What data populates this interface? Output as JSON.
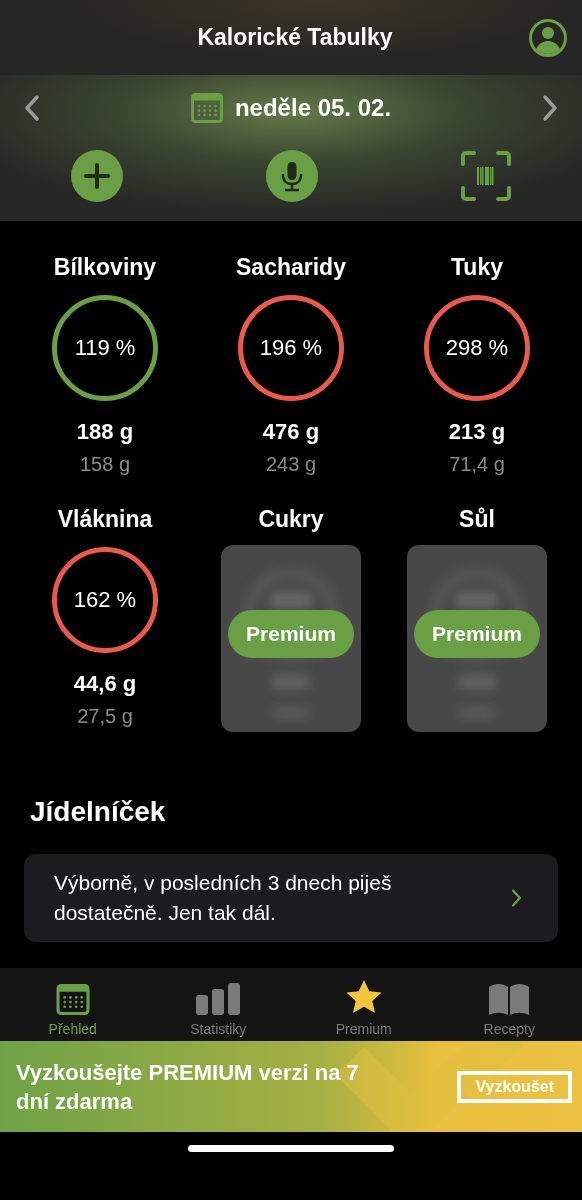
{
  "header": {
    "title": "Kalorické Tabulky"
  },
  "date_bar": {
    "date": "neděle 05. 02."
  },
  "actions": [
    {
      "kind": "add"
    },
    {
      "kind": "voice"
    },
    {
      "kind": "scan"
    }
  ],
  "nutrients": [
    {
      "kind": "ring",
      "name": "Bílkoviny",
      "percent": "119 %",
      "color": "#6a9f45",
      "amount": "188 g",
      "target": "158 g"
    },
    {
      "kind": "ring",
      "name": "Sacharidy",
      "percent": "196 %",
      "color": "#e85a4a",
      "amount": "476 g",
      "target": "243 g"
    },
    {
      "kind": "ring",
      "name": "Tuky",
      "percent": "298 %",
      "color": "#e85a4a",
      "amount": "213 g",
      "target": "71,4 g"
    },
    {
      "kind": "ring",
      "name": "Vláknina",
      "percent": "162 %",
      "color": "#e85a4a",
      "amount": "44,6 g",
      "target": "27,5 g"
    },
    {
      "kind": "locked",
      "name": "Cukry",
      "button": "Premium"
    },
    {
      "kind": "locked",
      "name": "Sůl",
      "button": "Premium"
    }
  ],
  "diary": {
    "heading": "Jídelníček",
    "message": "Výborně, v posledních 3 dnech piješ dostatečně. Jen tak dál."
  },
  "tabs": [
    {
      "kind": "calendar",
      "label": "Přehled",
      "selected": true
    },
    {
      "kind": "chart",
      "label": "Statistiky",
      "selected": false
    },
    {
      "kind": "star",
      "label": "Premium",
      "selected": false
    },
    {
      "kind": "book",
      "label": "Recepty",
      "selected": false
    }
  ],
  "banner": {
    "text": "Vyzkoušejte PREMIUM verzi na 7 dní zdarma",
    "button": "Vyzkoušet"
  }
}
